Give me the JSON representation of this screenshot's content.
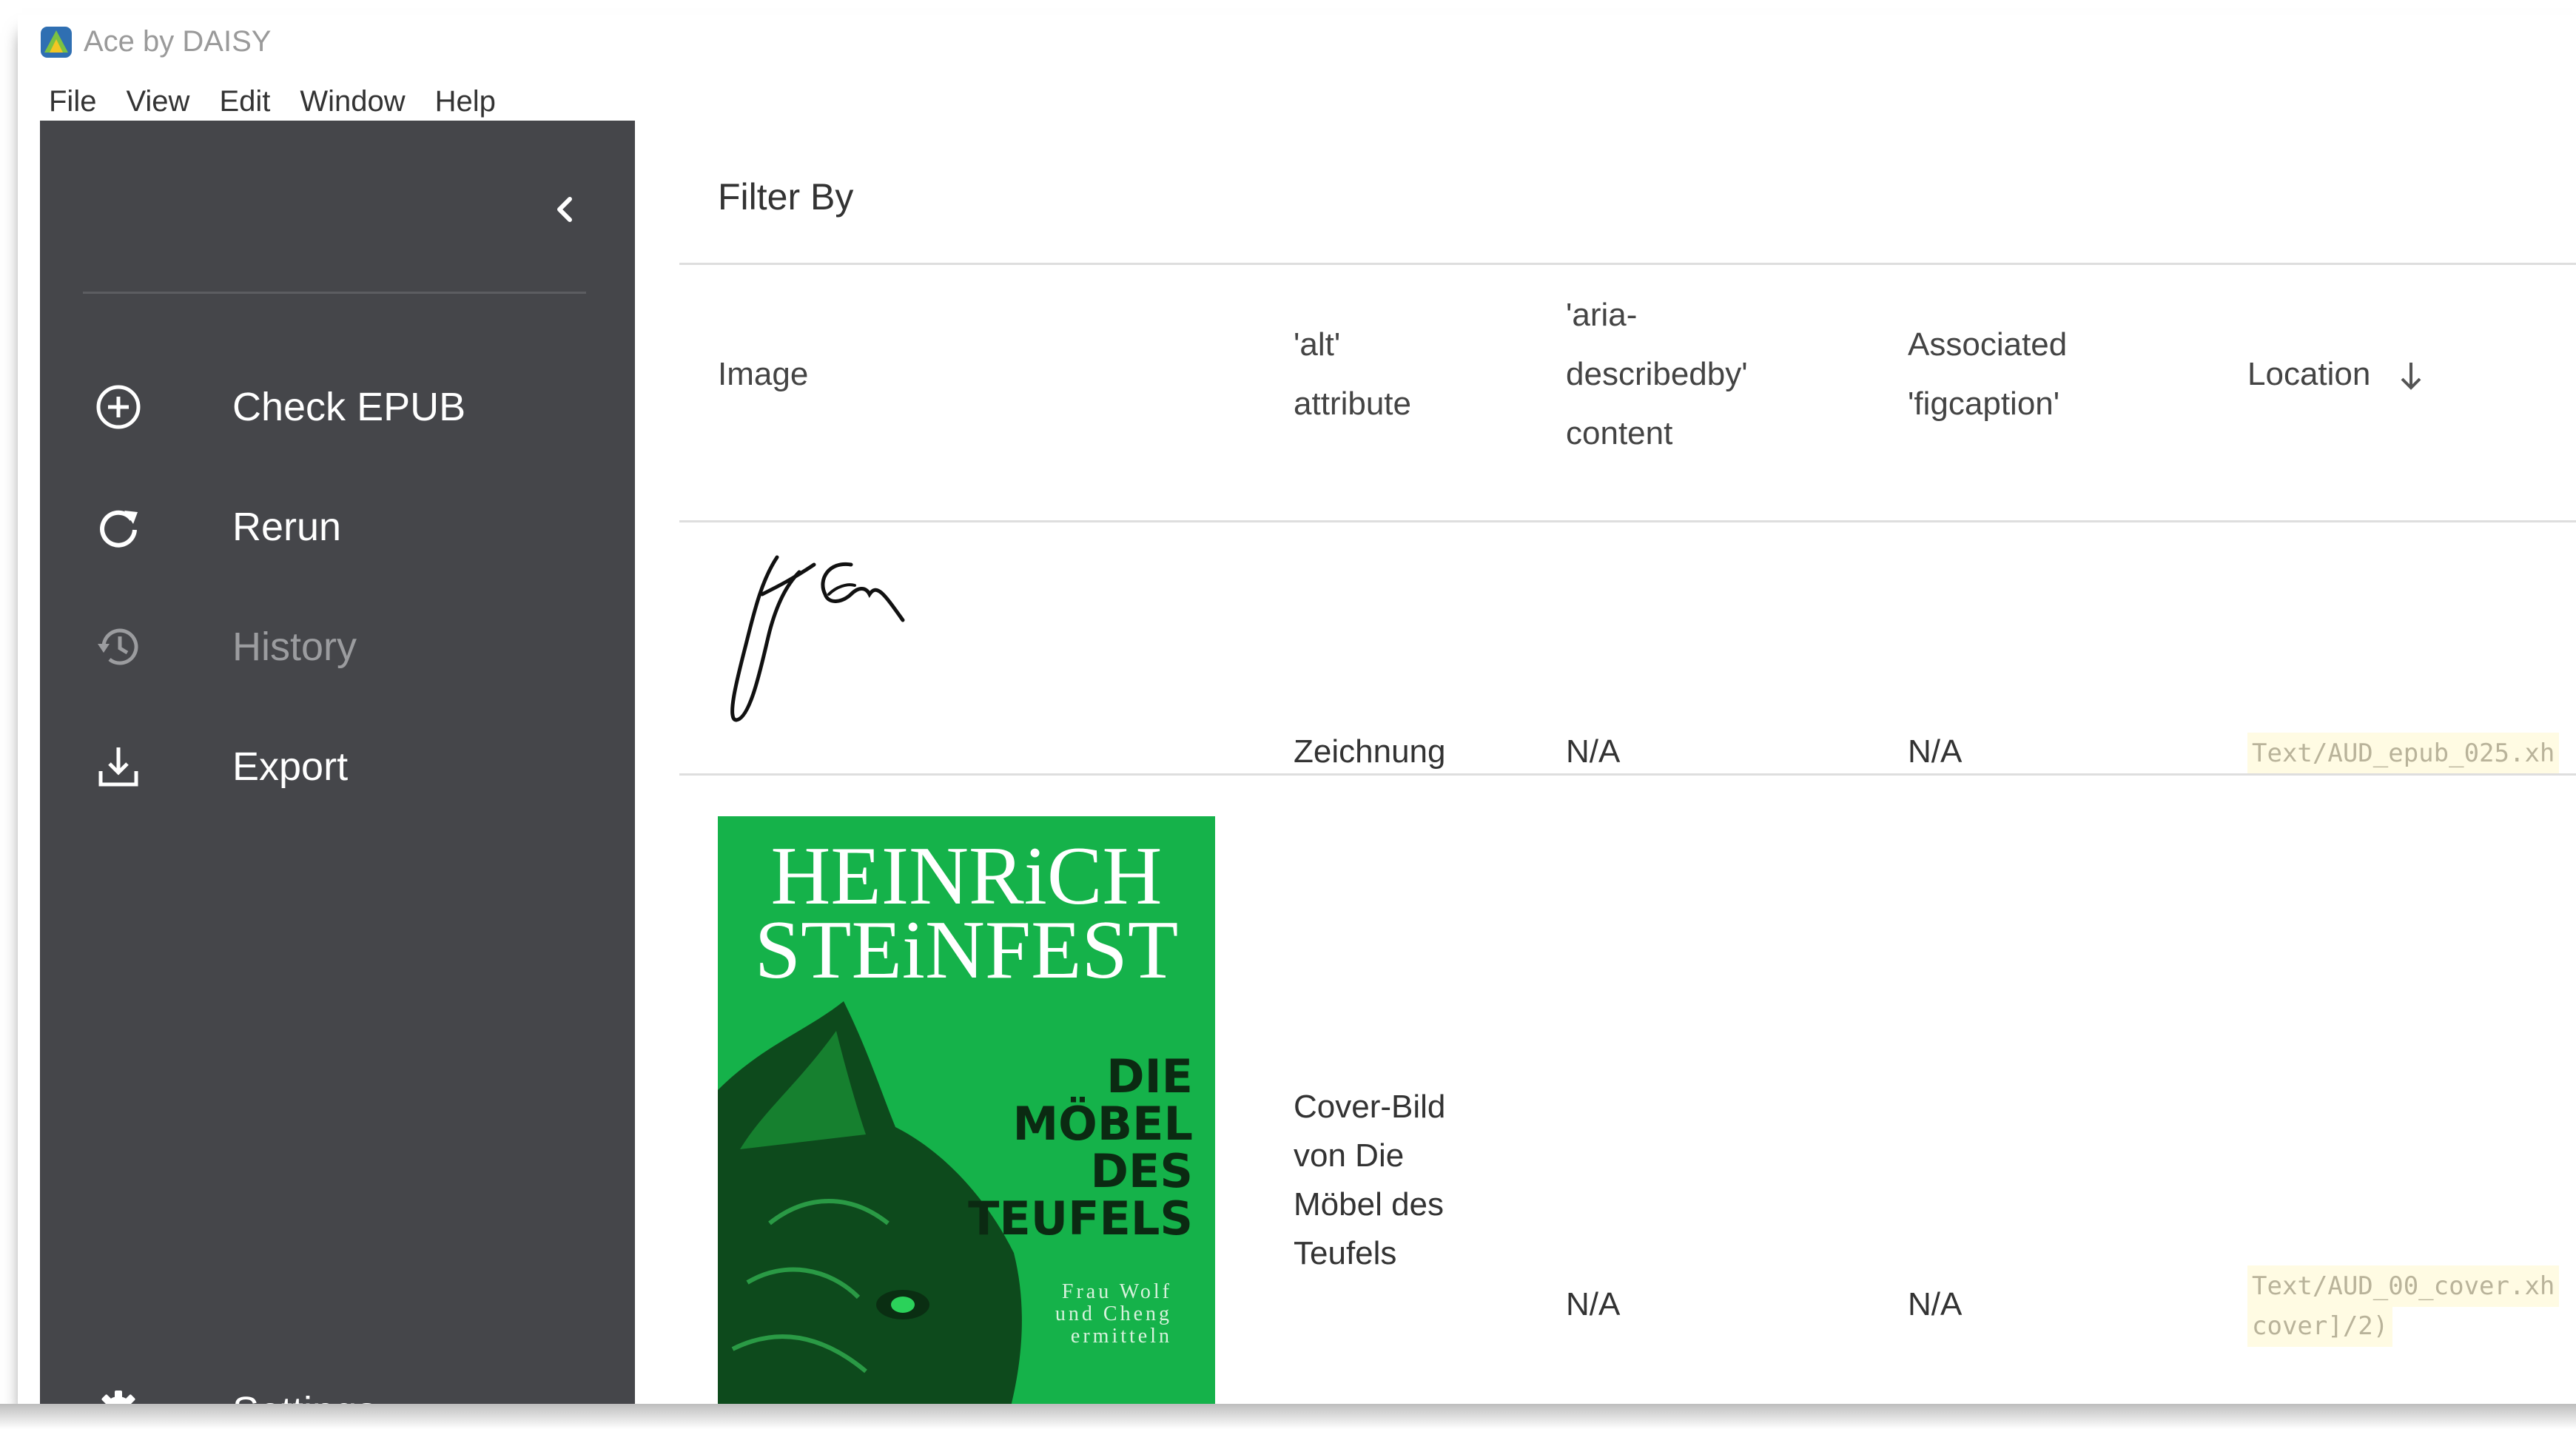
{
  "app": {
    "title": "Ace by DAISY",
    "menu": [
      "File",
      "View",
      "Edit",
      "Window",
      "Help"
    ]
  },
  "sidebar": {
    "items": [
      {
        "label": "Check EPUB",
        "icon": "add-circle-icon",
        "enabled": true
      },
      {
        "label": "Rerun",
        "icon": "refresh-icon",
        "enabled": true
      },
      {
        "label": "History",
        "icon": "history-icon",
        "enabled": false
      },
      {
        "label": "Export",
        "icon": "download-icon",
        "enabled": true
      }
    ],
    "settings_label": "Settings",
    "background": "#45464a"
  },
  "main": {
    "filter_label": "Filter By",
    "columns": {
      "image": "Image",
      "alt_1": "'alt'",
      "alt_2": "attribute",
      "aria_1": "'aria-",
      "aria_2": "describedby'",
      "aria_3": "content",
      "fig_1": "Associated",
      "fig_2": "'figcaption'",
      "location": "Location"
    },
    "rows": [
      {
        "alt": "Zeichnung",
        "aria": "N/A",
        "figcaption": "N/A",
        "location": "Text/AUD_epub_025.xh"
      },
      {
        "alt_lines": [
          "Cover-Bild",
          "von Die",
          "Möbel des",
          "Teufels"
        ],
        "aria": "N/A",
        "figcaption": "N/A",
        "location_1": "Text/AUD_00_cover.xh",
        "location_2": "cover]/2)",
        "cover": {
          "author_1": "HEINRiCH",
          "author_2": "STEiNFEST",
          "title_1": "DIE",
          "title_2": "MÖBEL",
          "title_3": "DES",
          "title_4": "TEUFELS",
          "subtitle_1": "Frau Wolf",
          "subtitle_2": "und Cheng",
          "subtitle_3": "ermitteln",
          "color": "#15b24a"
        }
      }
    ]
  }
}
